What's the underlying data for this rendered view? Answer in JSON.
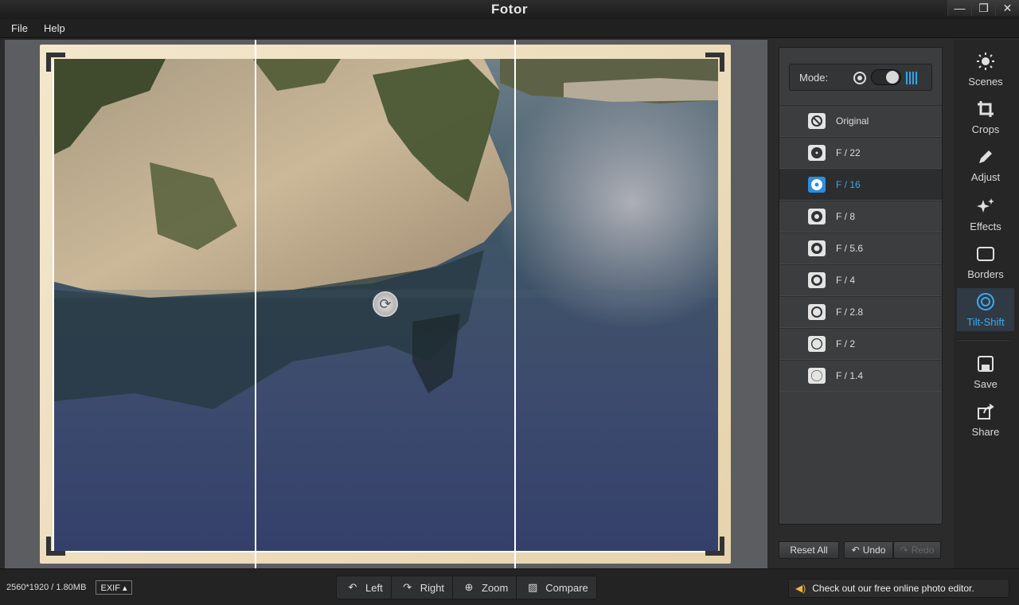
{
  "app": {
    "title": "Fotor"
  },
  "window": {
    "minimize": "—",
    "maximize": "❐",
    "close": "✕"
  },
  "menu": {
    "file": "File",
    "help": "Help"
  },
  "panel": {
    "mode_label": "Mode:",
    "items": [
      {
        "label": "Original"
      },
      {
        "label": "F / 22"
      },
      {
        "label": "F / 16"
      },
      {
        "label": "F / 8"
      },
      {
        "label": "F / 5.6"
      },
      {
        "label": "F / 4"
      },
      {
        "label": "F / 2.8"
      },
      {
        "label": "F / 2"
      },
      {
        "label": "F / 1.4"
      }
    ],
    "reset_all": "Reset All",
    "undo": "Undo",
    "redo": "Redo"
  },
  "sidebar": {
    "scenes": "Scenes",
    "crops": "Crops",
    "adjust": "Adjust",
    "effects": "Effects",
    "borders": "Borders",
    "tilt_shift": "Tilt-Shift",
    "save": "Save",
    "share": "Share"
  },
  "bottom": {
    "info": "2560*1920 / 1.80MB",
    "exif": "EXIF ▴",
    "left": "Left",
    "right": "Right",
    "zoom": "Zoom",
    "compare": "Compare",
    "promo": "Check out our free online photo editor."
  },
  "colors": {
    "accent": "#3aa9f0",
    "promo_icon": "#f3b33d"
  }
}
